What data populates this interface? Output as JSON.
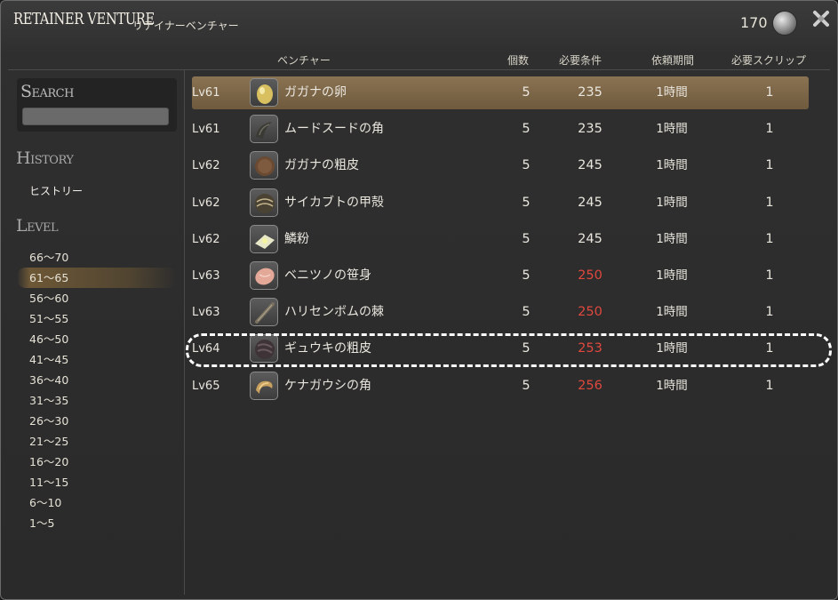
{
  "window": {
    "title_en": "RETAINER VENTURE",
    "title_jp": "リテイナーベンチャー",
    "scrip_count": "170"
  },
  "sidebar": {
    "search_label": "Search",
    "search_value": "",
    "history_label": "History",
    "history_item": "ヒストリー",
    "level_label": "Level",
    "levels": [
      "66～70",
      "61～65",
      "56～60",
      "51～55",
      "46～50",
      "41～45",
      "36～40",
      "31～35",
      "26～30",
      "21～25",
      "16～20",
      "11～15",
      "6～10",
      "1～5"
    ],
    "selected_level": "61～65"
  },
  "table": {
    "headers": {
      "venture": "ベンチャー",
      "qty": "個数",
      "req": "必要条件",
      "period": "依頼期間",
      "scrip": "必要スクリップ"
    },
    "rows": [
      {
        "lv": "Lv61",
        "name": "ガガナの卵",
        "qty": "5",
        "req": "235",
        "period": "1時間",
        "scrip": "1",
        "icon": "egg-icon",
        "req_color": "#e9e6de"
      },
      {
        "lv": "Lv61",
        "name": "ムードスードの角",
        "qty": "5",
        "req": "235",
        "period": "1時間",
        "scrip": "1",
        "icon": "horn-icon",
        "req_color": "#e9e6de"
      },
      {
        "lv": "Lv62",
        "name": "ガガナの粗皮",
        "qty": "5",
        "req": "245",
        "period": "1時間",
        "scrip": "1",
        "icon": "hide-icon",
        "req_color": "#e9e6de"
      },
      {
        "lv": "Lv62",
        "name": "サイカブトの甲殻",
        "qty": "5",
        "req": "245",
        "period": "1時間",
        "scrip": "1",
        "icon": "carapace-icon",
        "req_color": "#e9e6de"
      },
      {
        "lv": "Lv62",
        "name": "鱗粉",
        "qty": "5",
        "req": "245",
        "period": "1時間",
        "scrip": "1",
        "icon": "scale-powder-icon",
        "req_color": "#e9e6de"
      },
      {
        "lv": "Lv63",
        "name": "ベニツノの笹身",
        "qty": "5",
        "req": "250",
        "period": "1時間",
        "scrip": "1",
        "icon": "fish-fillet-icon",
        "req_color": "#e0483e"
      },
      {
        "lv": "Lv63",
        "name": "ハリセンボムの棘",
        "qty": "5",
        "req": "250",
        "period": "1時間",
        "scrip": "1",
        "icon": "spine-icon",
        "req_color": "#e0483e"
      },
      {
        "lv": "Lv64",
        "name": "ギュウキの粗皮",
        "qty": "5",
        "req": "253",
        "period": "1時間",
        "scrip": "1",
        "icon": "rough-hide-icon",
        "req_color": "#e0483e"
      },
      {
        "lv": "Lv65",
        "name": "ケナガウシの角",
        "qty": "5",
        "req": "256",
        "period": "1時間",
        "scrip": "1",
        "icon": "curled-horn-icon",
        "req_color": "#e0483e"
      }
    ],
    "selected_row": 0,
    "highlighted_row": 7
  },
  "colors": {
    "requirement_unmet": "#e0483e",
    "selection": "#8a7352"
  }
}
